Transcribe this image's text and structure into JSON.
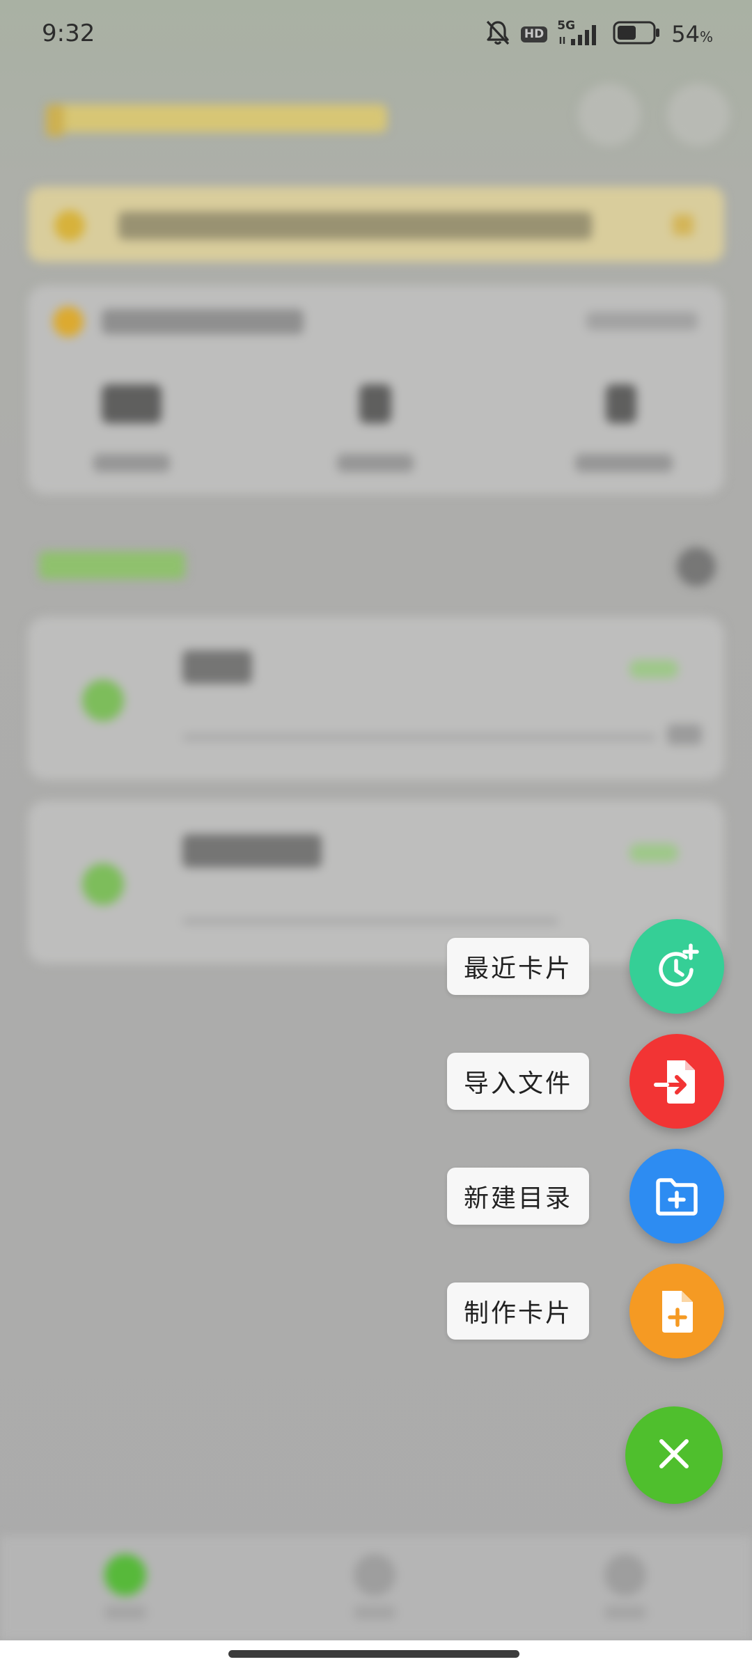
{
  "status_bar": {
    "time": "9:32",
    "network": "5G",
    "hd_badge": "HD",
    "battery_percent": "54",
    "battery_unit": "%",
    "battery_level": 0.54
  },
  "speed_dial": {
    "items": [
      {
        "label": "最近卡片",
        "icon": "clock-plus-icon",
        "color": "#35cf96"
      },
      {
        "label": "导入文件",
        "icon": "file-import-icon",
        "color": "#f23434"
      },
      {
        "label": "新建目录",
        "icon": "folder-plus-icon",
        "color": "#2d8cf2"
      },
      {
        "label": "制作卡片",
        "icon": "document-plus-icon",
        "color": "#f59a23"
      }
    ],
    "close_icon": "close-icon",
    "close_color": "#4fbf2d"
  }
}
